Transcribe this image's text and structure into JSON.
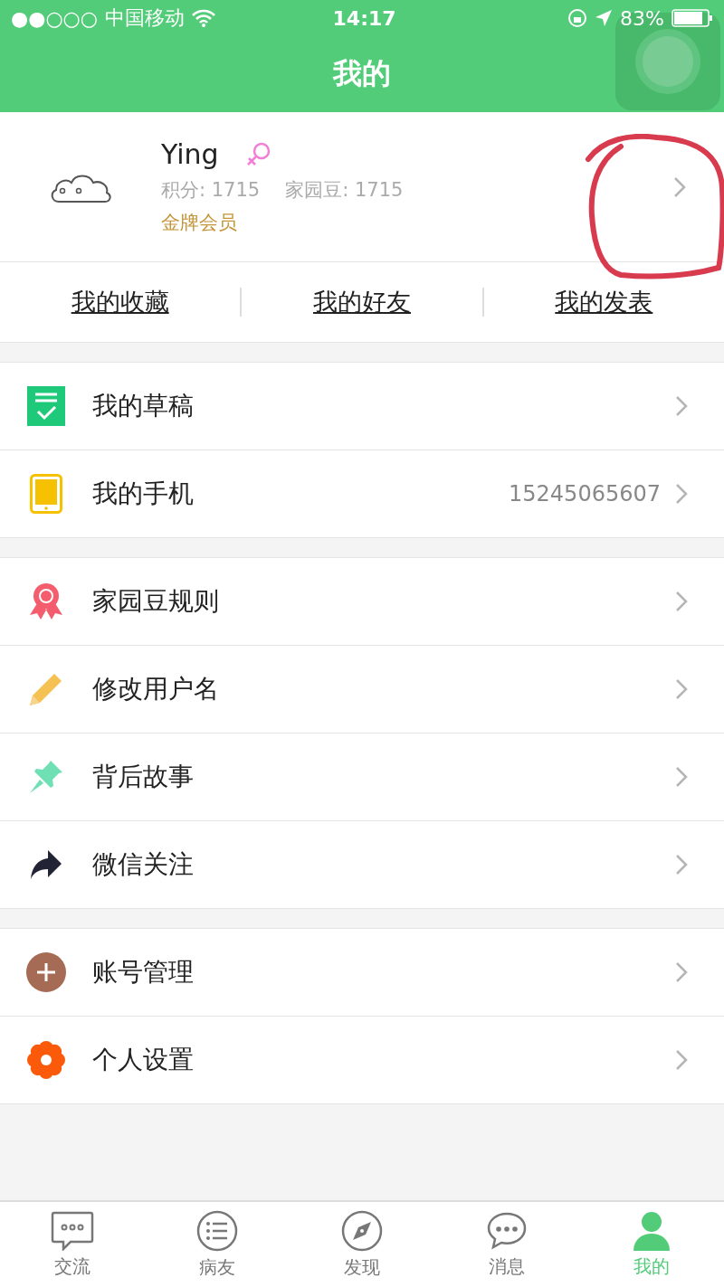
{
  "status_bar": {
    "signal": "●●○○○",
    "carrier": "中国移动",
    "time": "14:17",
    "battery": "83%"
  },
  "header": {
    "title": "我的"
  },
  "profile": {
    "name": "Ying",
    "points": "积分: 1715",
    "beans": "家园豆: 1715",
    "membership": "金牌会员"
  },
  "links": [
    "我的收藏",
    "我的好友",
    "我的发表"
  ],
  "groups": [
    [
      {
        "label": "我的草稿"
      },
      {
        "label": "我的手机",
        "value": "15245065607"
      }
    ],
    [
      {
        "label": "家园豆规则"
      },
      {
        "label": "修改用户名"
      },
      {
        "label": "背后故事"
      },
      {
        "label": "微信关注"
      }
    ],
    [
      {
        "label": "账号管理"
      },
      {
        "label": "个人设置"
      }
    ]
  ],
  "tabs": [
    {
      "label": "交流",
      "selected": false
    },
    {
      "label": "病友",
      "selected": false
    },
    {
      "label": "发现",
      "selected": false
    },
    {
      "label": "消息",
      "selected": false
    },
    {
      "label": "我的",
      "selected": true
    }
  ]
}
